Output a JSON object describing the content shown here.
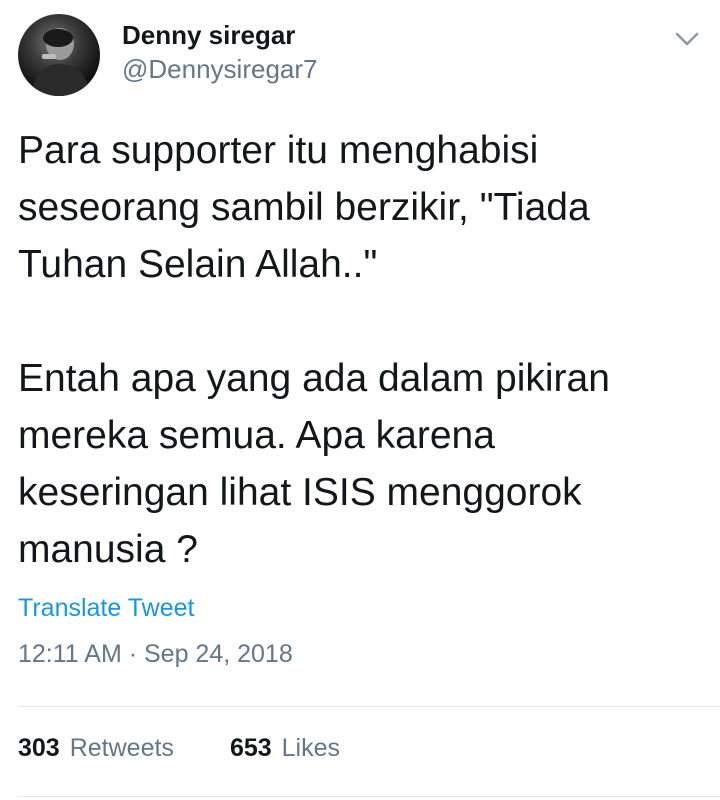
{
  "author": {
    "display_name": "Denny siregar",
    "handle": "@Dennysiregar7"
  },
  "tweet": {
    "text": "Para supporter itu menghabisi\nseseorang sambil berzikir, \"Tiada\nTuhan Selain Allah..\"\n\nEntah apa yang ada dalam pikiran\nmereka semua. Apa karena\nkeseringan lihat ISIS menggorok\nmanusia ?",
    "translate_label": "Translate Tweet",
    "timestamp": "12:11 AM · Sep 24, 2018"
  },
  "stats": {
    "retweets_count": "303",
    "retweets_label": "Retweets",
    "likes_count": "653",
    "likes_label": "Likes"
  },
  "icons": {
    "caret": "chevron-down-icon"
  },
  "colors": {
    "link": "#1b95e0",
    "secondary_text": "#657786",
    "primary_text": "#14171a",
    "divider": "#e1e8ed"
  }
}
